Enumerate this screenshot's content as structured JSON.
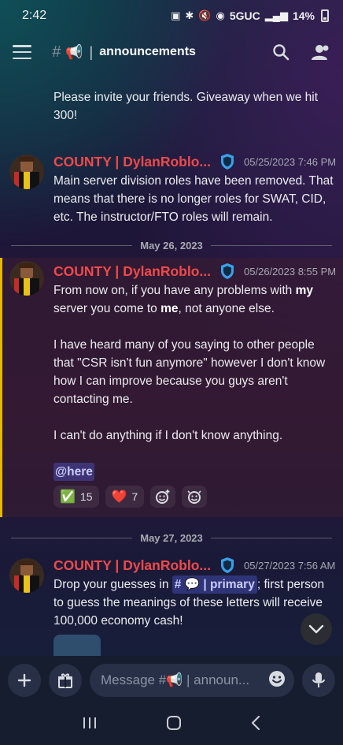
{
  "status_bar": {
    "time": "2:42",
    "network": "5GUC",
    "battery": "14%"
  },
  "channel": {
    "hash": "#",
    "emoji": "📢",
    "separator": "|",
    "name": "announcements"
  },
  "messages": [
    {
      "continuation": true,
      "lines": [
        "Please invite your friends. Giveaway when we hit",
        "300!"
      ]
    },
    {
      "author": "COUNTY | DylanRoblo...",
      "timestamp": "05/25/2023 7:46 PM",
      "lines": [
        "Main server division roles have been removed. That",
        "means that there is no longer roles for SWAT, CID,",
        "etc. The instructor/FTO roles will remain."
      ]
    },
    {
      "author": "COUNTY | DylanRoblo...",
      "timestamp": "05/26/2023 8:55 PM",
      "p1_a": "From now on, if you have any problems with ",
      "p1_b": "my",
      "p1_c": "server you come to ",
      "p1_d": "me",
      "p1_e": ", not anyone else.",
      "p2": [
        "I have heard many of you saying to other people",
        "that \"CSR isn't fun anymore\" however I don't know",
        "how I can improve because you guys aren't",
        "contacting me."
      ],
      "p3": "I can't do anything if I don't know anything.",
      "mention": "@here",
      "reactions": [
        {
          "emoji": "✅",
          "count": "15"
        },
        {
          "emoji": "❤️",
          "count": "7"
        }
      ]
    },
    {
      "author": "COUNTY | DylanRoblo...",
      "timestamp": "05/27/2023 7:56 AM",
      "l1_a": "Drop your guesses in ",
      "channel_link": "# 💬 | primary",
      "l1_b": "; first person",
      "lines": [
        "to guess the meanings of these letters will receive",
        "100,000 economy cash!"
      ]
    }
  ],
  "dividers": [
    "May 26, 2023",
    "May 27, 2023"
  ],
  "composer": {
    "placeholder": "Message #📢 | announ..."
  }
}
